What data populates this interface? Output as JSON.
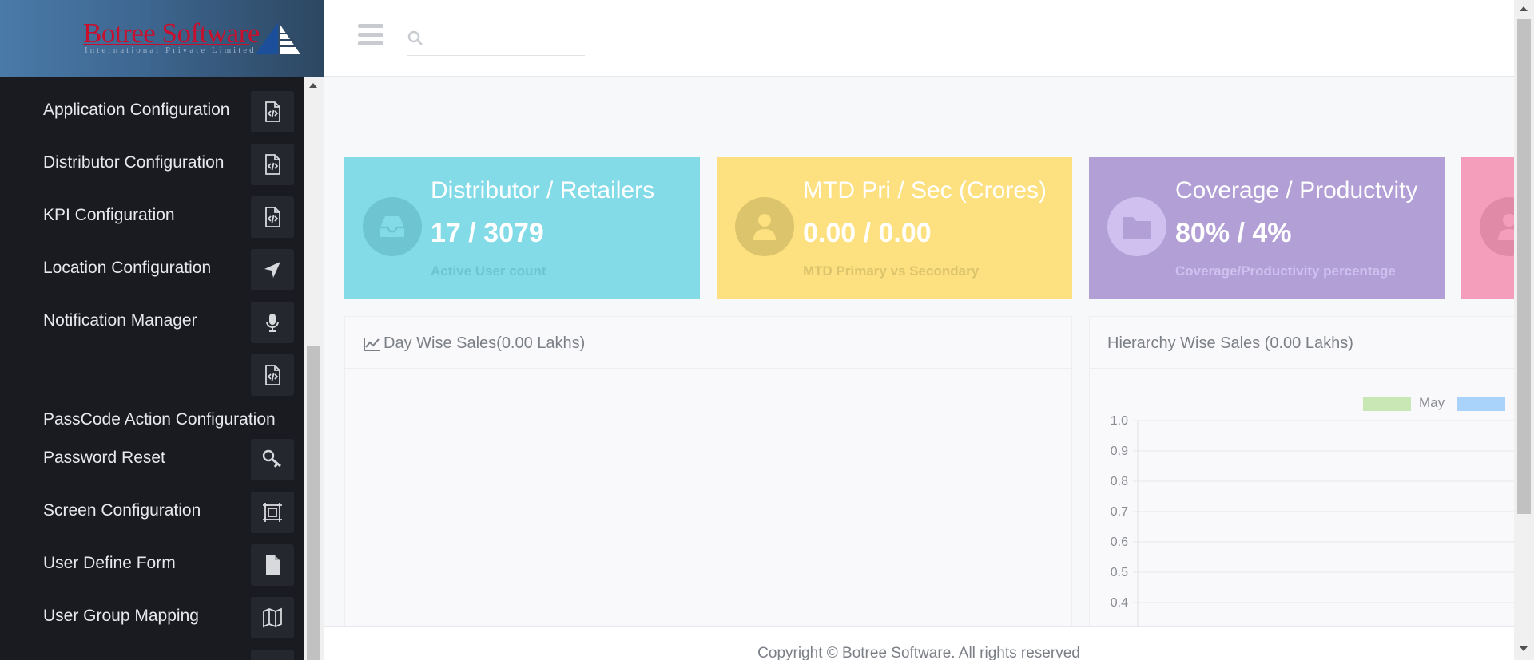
{
  "brand": {
    "name": "Botree Software",
    "tagline": "International Private Limited"
  },
  "search": {
    "placeholder": "",
    "value": ""
  },
  "sidebar": {
    "items": [
      {
        "label": "Application Configuration",
        "icon": "code-file-icon"
      },
      {
        "label": "Distributor Configuration",
        "icon": "code-file-icon"
      },
      {
        "label": "KPI Configuration",
        "icon": "code-file-icon"
      },
      {
        "label": "Location Configuration",
        "icon": "location-arrow-icon"
      },
      {
        "label": "Notification Manager",
        "icon": "microphone-icon"
      },
      {
        "label": "",
        "icon": "code-file-icon"
      },
      {
        "label": "PassCode Action Configuration",
        "icon": ""
      },
      {
        "label": "Password Reset",
        "icon": "key-icon"
      },
      {
        "label": "Screen Configuration",
        "icon": "screen-frame-icon"
      },
      {
        "label": "User Define Form",
        "icon": "file-icon"
      },
      {
        "label": "User Group Mapping",
        "icon": "map-icon"
      }
    ]
  },
  "cards": [
    {
      "title": "Distributor / Retailers",
      "value": "17 / 3079",
      "desc": "Active User count",
      "color": "#84dbe8",
      "icon": "inbox-icon"
    },
    {
      "title": "MTD Pri / Sec (Crores)",
      "value": "0.00 / 0.00",
      "desc": "MTD Primary vs Secondary",
      "color": "#fde07f",
      "icon": "user-icon"
    },
    {
      "title": "Coverage / Productvity",
      "value": "80% / 4%",
      "desc": "Coverage/Productivity percentage",
      "color": "#b19fd6",
      "icon": "folder-icon"
    },
    {
      "title": "",
      "value": "",
      "desc": "",
      "color": "#f59ebc",
      "icon": "user-icon"
    }
  ],
  "panels": {
    "day_wise": {
      "title": "Day Wise Sales(0.00 Lakhs)",
      "icon": "line-chart-icon"
    },
    "hierarchy": {
      "title": "Hierarchy Wise Sales (0.00 Lakhs)"
    }
  },
  "chart_data": {
    "type": "bar",
    "title": "",
    "legend_position": "top",
    "series": [
      {
        "name": "May",
        "color": "#c9e6b5",
        "values": []
      },
      {
        "name": "",
        "color": "#a9d3fb",
        "values": []
      }
    ],
    "ylim": [
      0.4,
      1.0
    ],
    "yticks": [
      "1.0",
      "0.9",
      "0.8",
      "0.7",
      "0.6",
      "0.5",
      "0.4"
    ],
    "grid": true
  },
  "footer": {
    "text": "Copyright © Botree Software. All rights reserved"
  }
}
